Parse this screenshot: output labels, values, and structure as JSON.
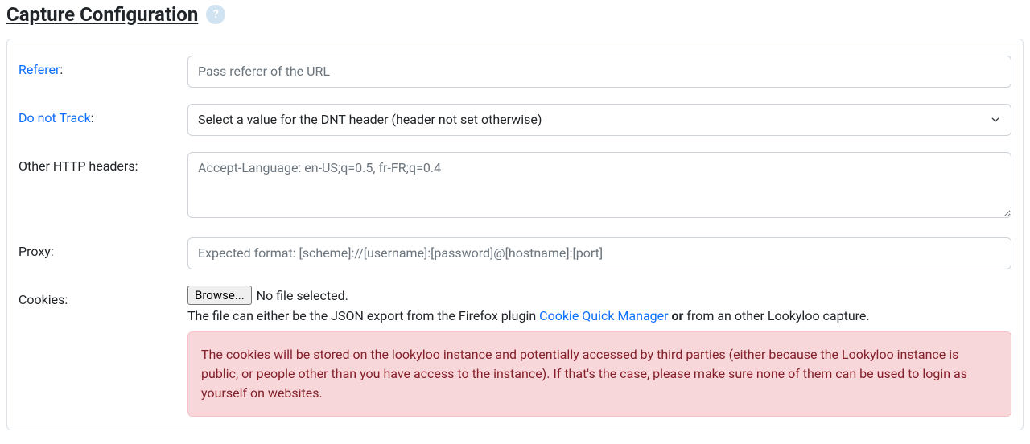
{
  "title": "Capture Configuration",
  "help_icon_char": "?",
  "fields": {
    "referer": {
      "label": "Referer",
      "placeholder": "Pass referer of the URL"
    },
    "dnt": {
      "label": "Do not Track",
      "selected": "Select a value for the DNT header (header not set otherwise)"
    },
    "other_headers": {
      "label": "Other HTTP headers:",
      "placeholder": "Accept-Language: en-US;q=0.5, fr-FR;q=0.4"
    },
    "proxy": {
      "label": "Proxy:",
      "placeholder": "Expected format: [scheme]://[username]:[password]@[hostname]:[port]"
    },
    "cookies": {
      "label": "Cookies:",
      "browse_button": "Browse...",
      "file_status": "No file selected.",
      "help_prefix": "The file can either be the JSON export from the Firefox plugin ",
      "help_link": "Cookie Quick Manager",
      "help_or": "or",
      "help_suffix": " from an other Lookyloo capture.",
      "warning": "The cookies will be stored on the lookyloo instance and potentially accessed by third parties (either because the Lookyloo instance is public, or people other than you have access to the instance). If that's the case, please make sure none of them can be used to login as yourself on websites."
    }
  }
}
